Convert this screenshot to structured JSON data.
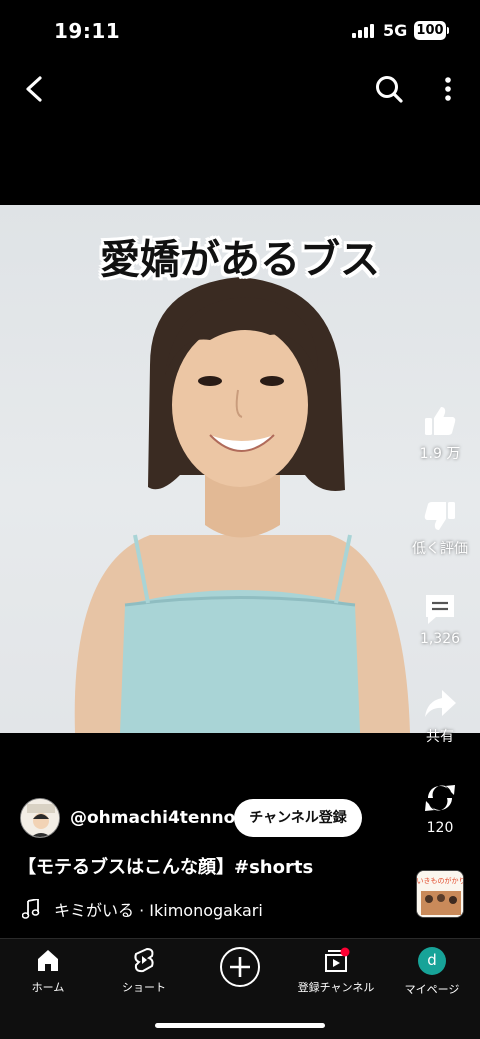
{
  "status_bar": {
    "time": "19:11",
    "network": "5G",
    "battery": "100"
  },
  "video": {
    "overlay_title": "愛嬌があるブス"
  },
  "actions": {
    "like_count": "1.9 万",
    "dislike_label": "低く評価",
    "comment_count": "1,326",
    "share_label": "共有",
    "remix_count": "120"
  },
  "channel": {
    "handle": "@ohmachi4tennou",
    "subscribe_label": "チャンネル登録"
  },
  "title": "【モテるブスはこんな顔】#shorts",
  "music": {
    "text": "キミがいる · Ikimonogakari",
    "thumb_text": "いきものがかり"
  },
  "bottom_nav": {
    "home": "ホーム",
    "shorts": "ショート",
    "subscriptions": "登録チャンネル",
    "you": "マイページ",
    "you_initial": "d"
  },
  "colors": {
    "background": "#000000",
    "notification_dot": "#ff0033",
    "avatar_teal": "#17a398"
  }
}
